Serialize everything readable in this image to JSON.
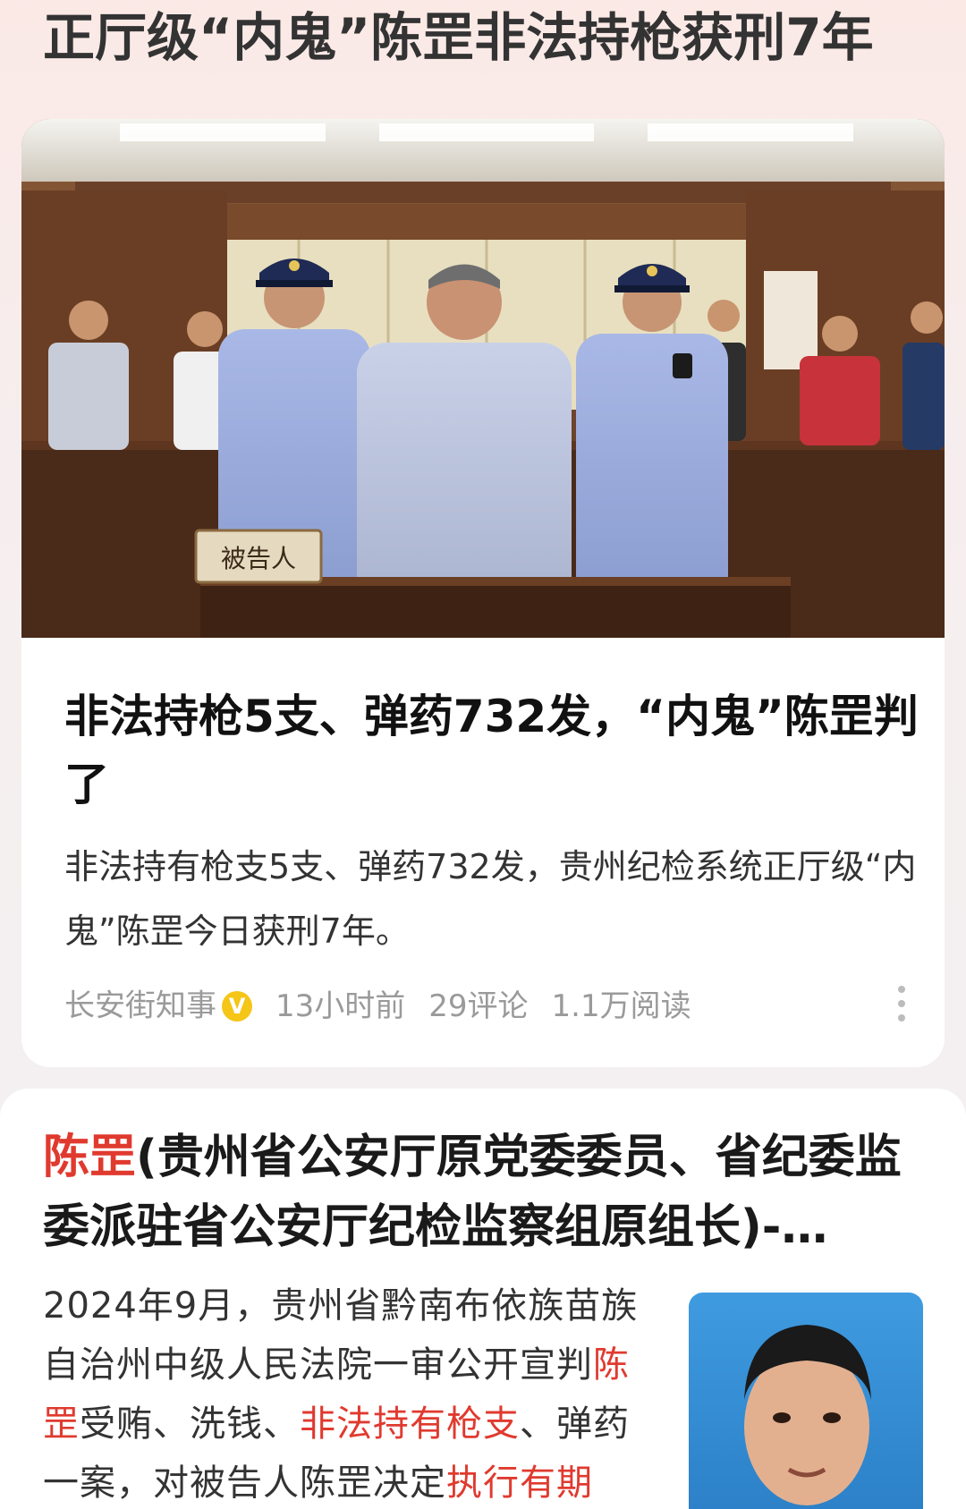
{
  "page": {
    "title": "正厅级“内鬼”陈罡非法持枪获刑7年"
  },
  "article1": {
    "photo_sign": "被告人",
    "title": "非法持枪5支、弹药732发，“内鬼”陈罡判了",
    "summary": "非法持有枪支5支、弹药732发，贵州纪检系统正厅级“内鬼”陈罡今日获刑7年。",
    "meta": {
      "source": "长安街知事",
      "verified_badge": "V",
      "time": "13小时前",
      "comments": "29评论",
      "reads": "1.1万阅读"
    },
    "icons": [
      "verified-badge-icon",
      "more-options-icon"
    ],
    "badge_color": "#f5c518"
  },
  "article2": {
    "title_highlight": "陈罡",
    "title_rest": "(贵州省公安厅原党委委员、省纪委监委派驻省公安厅纪检监察组原组长)-…",
    "body": {
      "p1": "2024年9月，贵州省黔南布依族苗族自治州中级人民法院一审公开宣判",
      "h1": "陈罡",
      "p2": "受贿、洗钱、",
      "h2": "非法持有枪支",
      "p3": "、弹药一案，对被告人陈罡决定",
      "h3": "执行有期"
    },
    "highlight_color": "#e03a2f"
  }
}
